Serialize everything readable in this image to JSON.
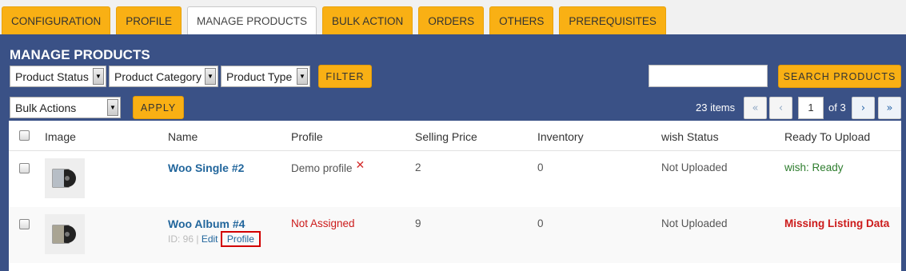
{
  "tabs": [
    {
      "label": "CONFIGURATION",
      "active": false
    },
    {
      "label": "PROFILE",
      "active": false
    },
    {
      "label": "MANAGE PRODUCTS",
      "active": true
    },
    {
      "label": "BULK ACTION",
      "active": false
    },
    {
      "label": "ORDERS",
      "active": false
    },
    {
      "label": "OTHERS",
      "active": false
    },
    {
      "label": "PREREQUISITES",
      "active": false
    }
  ],
  "panel": {
    "title": "MANAGE PRODUCTS",
    "filters": {
      "product_status": "Product Status",
      "product_category": "Product Category",
      "product_type": "Product Type",
      "filter_button": "FILTER"
    },
    "search": {
      "value": "",
      "button": "SEARCH PRODUCTS"
    },
    "bulk": {
      "select": "Bulk Actions",
      "apply": "APPLY"
    },
    "pagination": {
      "items": "23 items",
      "first": "«",
      "prev": "‹",
      "current_page": "1",
      "of_total": "of 3",
      "next": "›",
      "last": "»"
    }
  },
  "table": {
    "headers": {
      "image": "Image",
      "name": "Name",
      "profile": "Profile",
      "price": "Selling Price",
      "inventory": "Inventory",
      "status": "wish Status",
      "ready": "Ready To Upload"
    },
    "rows": [
      {
        "name": "Woo Single #2",
        "profile": "Demo profile",
        "remove_profile": "✕",
        "price": "2",
        "inventory": "0",
        "status": "Not Uploaded",
        "ready": "wish: Ready"
      },
      {
        "name": "Woo Album #4",
        "id_label": "ID: 96",
        "separator": "|",
        "edit": "Edit",
        "profile_link": "Profile",
        "profile": "Not Assigned",
        "price": "9",
        "inventory": "0",
        "status": "Not Uploaded",
        "ready": "Missing Listing Data"
      }
    ]
  },
  "colors": {
    "accent": "#f9b014",
    "panel": "#3a5186",
    "link": "#22669c",
    "error": "#cc1a1a",
    "success": "#2e7d2e"
  }
}
